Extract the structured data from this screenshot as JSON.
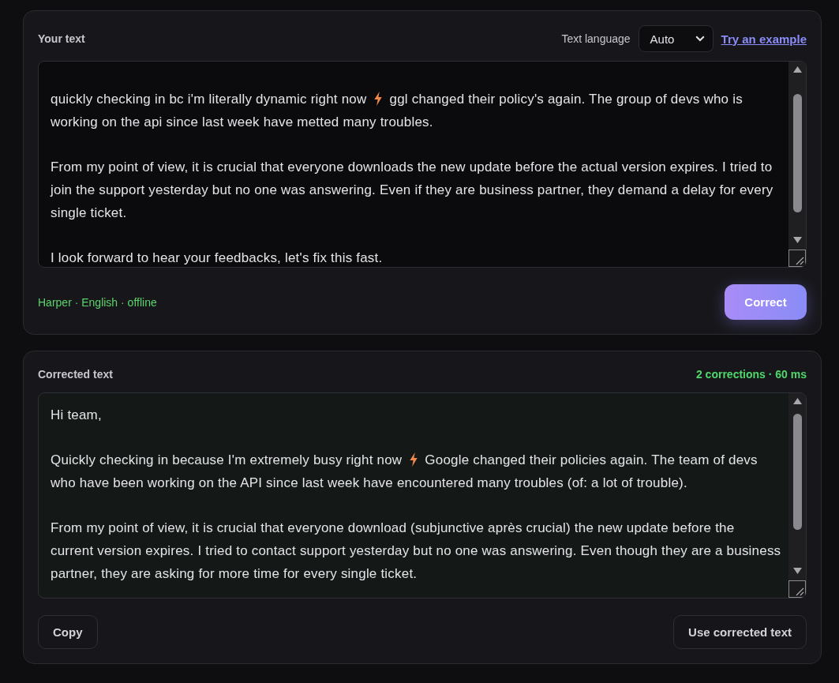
{
  "input_card": {
    "title": "Your text",
    "language_label": "Text language",
    "language_select": {
      "value": "Auto"
    },
    "example_link": "Try an example",
    "text_paragraphs": [
      {
        "lines": [
          {
            "segments": [
              {
                "kind": "text",
                "text": "quickly checking in bc i'm literally dynamic right now"
              },
              {
                "kind": "emoji"
              },
              {
                "kind": "text",
                "text": "ggl changed their policy's again. The group of devs who is"
              }
            ]
          },
          {
            "segments": [
              {
                "kind": "text",
                "text": "working on the api since last week have metted many troubles."
              }
            ]
          }
        ]
      },
      {
        "lines": [
          {
            "segments": [
              {
                "kind": "text",
                "text": "From my point of view, it is crucial that everyone downloads the new update before the actual version expires. I tried to"
              }
            ]
          },
          {
            "segments": [
              {
                "kind": "text",
                "text": "join the support yesterday but no one was answering. Even if they are business partner, they demand a delay for every"
              }
            ]
          },
          {
            "segments": [
              {
                "kind": "text",
                "text": "single ticket."
              }
            ]
          }
        ]
      },
      {
        "lines": [
          {
            "segments": [
              {
                "kind": "text",
                "text": "I look forward to hear your feedbacks, let's fix this fast."
              }
            ]
          }
        ]
      }
    ],
    "status": "Harper · English · offline",
    "correct_button": "Correct"
  },
  "output_card": {
    "title": "Corrected text",
    "summary": "2 corrections · 60 ms",
    "text_paragraphs": [
      {
        "lines": [
          {
            "segments": [
              {
                "kind": "text",
                "text": "Hi team,"
              }
            ]
          }
        ]
      },
      {
        "lines": [
          {
            "segments": [
              {
                "kind": "text",
                "text": "Quickly checking in because I'm extremely busy right now"
              },
              {
                "kind": "emoji"
              },
              {
                "kind": "text",
                "text": "Google changed their policies again. The team of devs"
              }
            ]
          },
          {
            "segments": [
              {
                "kind": "text",
                "text": "who have been working on the API since last week have encountered many troubles (of: a lot of trouble)."
              }
            ]
          }
        ]
      },
      {
        "lines": [
          {
            "segments": [
              {
                "kind": "text",
                "text": "From my point of view, it is crucial that everyone download (subjunctive après crucial) the new update before the"
              }
            ]
          },
          {
            "segments": [
              {
                "kind": "text",
                "text": "current version expires. I tried to contact support yesterday but no one was answering. Even though they are a business"
              }
            ]
          },
          {
            "segments": [
              {
                "kind": "text",
                "text": "partner, they are asking for more time for every single ticket."
              }
            ]
          }
        ]
      }
    ],
    "buttons": [
      {
        "label": "Copy"
      },
      {
        "label": "Use corrected text"
      }
    ]
  }
}
